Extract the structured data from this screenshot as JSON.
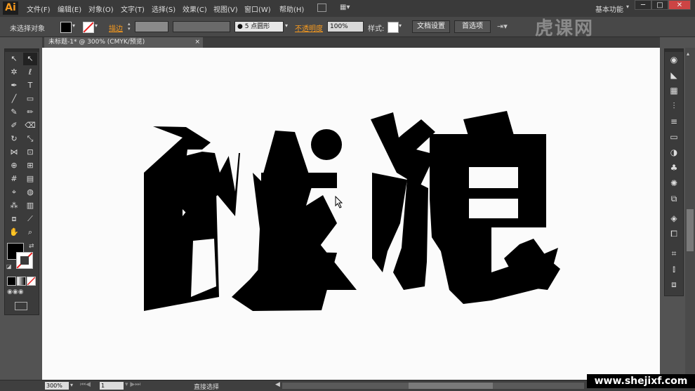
{
  "app": {
    "logo": "Ai",
    "workspace": "基本功能"
  },
  "menu": [
    "文件(F)",
    "编辑(E)",
    "对象(O)",
    "文字(T)",
    "选择(S)",
    "效果(C)",
    "视图(V)",
    "窗口(W)",
    "帮助(H)"
  ],
  "window_controls": {
    "min": "─",
    "max": "□",
    "close": "✕"
  },
  "control_bar": {
    "selection": "未选择对象",
    "stroke_label": "描边",
    "brush": "5 点圆形",
    "opacity_label": "不透明度",
    "opacity_value": "100%",
    "style_label": "样式:",
    "doc_setup": "文档设置",
    "preferences": "首选项"
  },
  "document_tab": {
    "title": "未标题-1* @ 300% (CMYK/预览)",
    "close": "×"
  },
  "status": {
    "zoom": "300%",
    "artboard": "1",
    "tool": "直接选择"
  },
  "watermark": {
    "site": "www.shejixf.com",
    "brand": "虎课网"
  },
  "colors": {
    "canvas": "#fbfbfb",
    "ui_dark": "#3b3b3b",
    "accent": "#f79a1e",
    "glyph": "#000000"
  }
}
